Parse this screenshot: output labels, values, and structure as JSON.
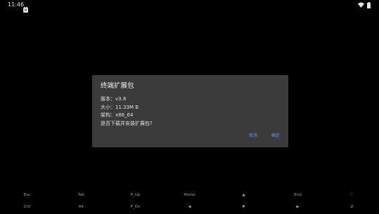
{
  "status_bar": {
    "time": "11:46",
    "app_icon": "termux-notification-icon",
    "wifi_icon": "wifi-icon",
    "battery_icon": "battery-icon"
  },
  "dialog": {
    "title": "终端扩展包",
    "lines": [
      "版本：v3.8",
      "大小：11.33M B",
      "架构：x86_64",
      "是否下载并安装扩展包?"
    ],
    "cancel_label": "取消",
    "confirm_label": "确定",
    "accent_color": "#4d9cf0"
  },
  "extra_keys": {
    "row1": [
      "Esc",
      "Tab",
      "P_Up",
      "Home",
      "▲",
      "End",
      "⋮"
    ],
    "row2": [
      "Ctrl",
      "Alt",
      "P_Dn",
      "◀",
      "▼",
      "▶",
      "⇄"
    ]
  }
}
